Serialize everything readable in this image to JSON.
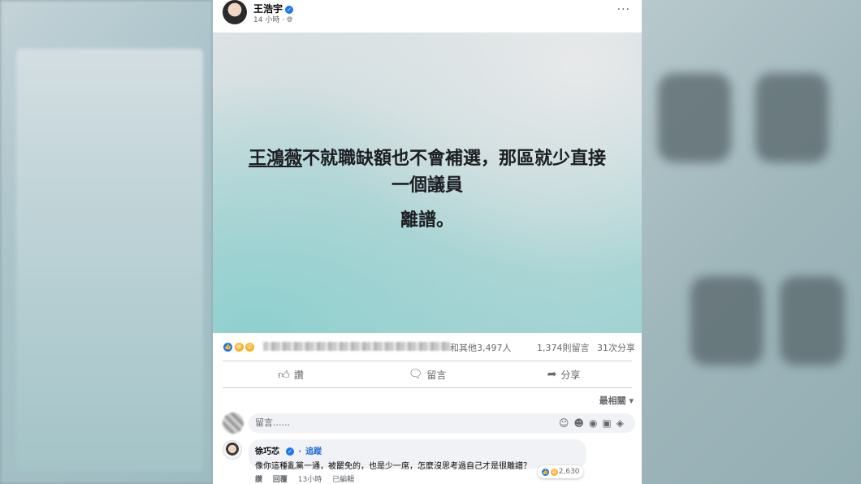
{
  "post": {
    "author": "王浩宇",
    "time": "14 小時",
    "more": "···",
    "image_text": {
      "line1_name": "王鴻薇",
      "line1_rest": "不就職缺額也不會補選，那區就少直接",
      "line2": "一個議員",
      "line3": "離譜。"
    },
    "reactions_others": "和其他3,497人",
    "comments_count": "1,374則留言",
    "shares_count": "31次分享",
    "actions": {
      "like": "讚",
      "comment": "留言",
      "share": "分享"
    },
    "sort_label": "最相關",
    "comment_placeholder": "留言......",
    "comment": {
      "name": "徐巧芯",
      "follow": "追蹤",
      "text": "像你這種亂黨一通，被罷免的，也是少一席，怎麼沒思考過自己才是很離譜？",
      "reaction_count": "2,630",
      "like": "讚",
      "reply": "回覆",
      "time": "13小時",
      "edited": "已編輯"
    }
  },
  "colors": {
    "accent": "#1877f2",
    "secondary_text": "#65676b"
  }
}
